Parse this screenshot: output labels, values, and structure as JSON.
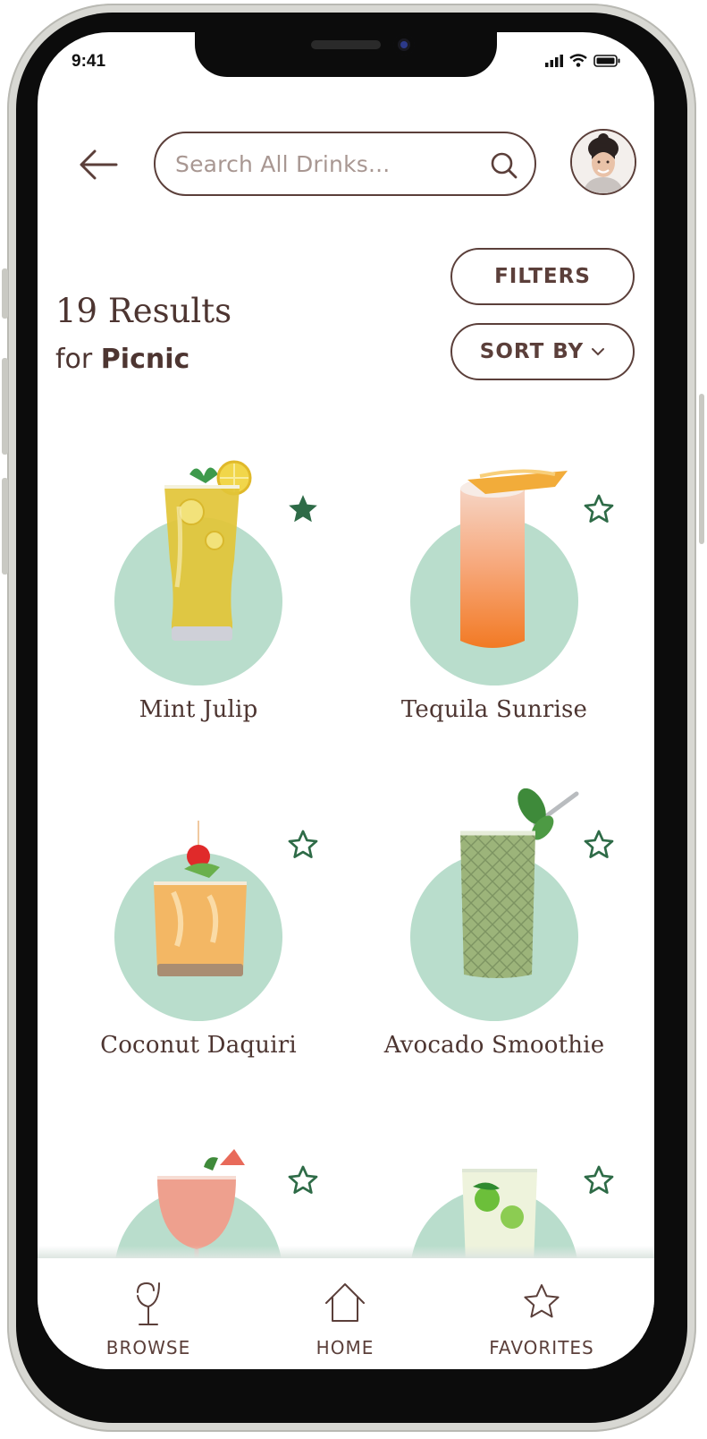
{
  "status_bar": {
    "time": "9:41",
    "icons": [
      "signal-icon",
      "wifi-icon",
      "battery-icon"
    ]
  },
  "header": {
    "search_placeholder": "Search All Drinks...",
    "icons": {
      "back": "arrow-left-icon",
      "search": "search-icon",
      "avatar": "user-avatar"
    }
  },
  "results": {
    "count_label": "19 Results",
    "for_prefix": "for",
    "query": "Picnic"
  },
  "controls": {
    "filters_label": "FILTERS",
    "sort_label": "SORT BY"
  },
  "drinks": [
    {
      "name": "Mint Julip",
      "favorited": true
    },
    {
      "name": "Tequila Sunrise",
      "favorited": false
    },
    {
      "name": "Coconut Daquiri",
      "favorited": false
    },
    {
      "name": "Avocado Smoothie",
      "favorited": false
    },
    {
      "name": "",
      "favorited": false
    },
    {
      "name": "",
      "favorited": false
    }
  ],
  "bottom_nav": {
    "browse": "BROWSE",
    "home": "HOME",
    "favorites": "FAVORITES"
  },
  "colors": {
    "brown": "#5b3f3a",
    "mint": "#b9ddcc",
    "fav_green": "#2e6b47"
  }
}
